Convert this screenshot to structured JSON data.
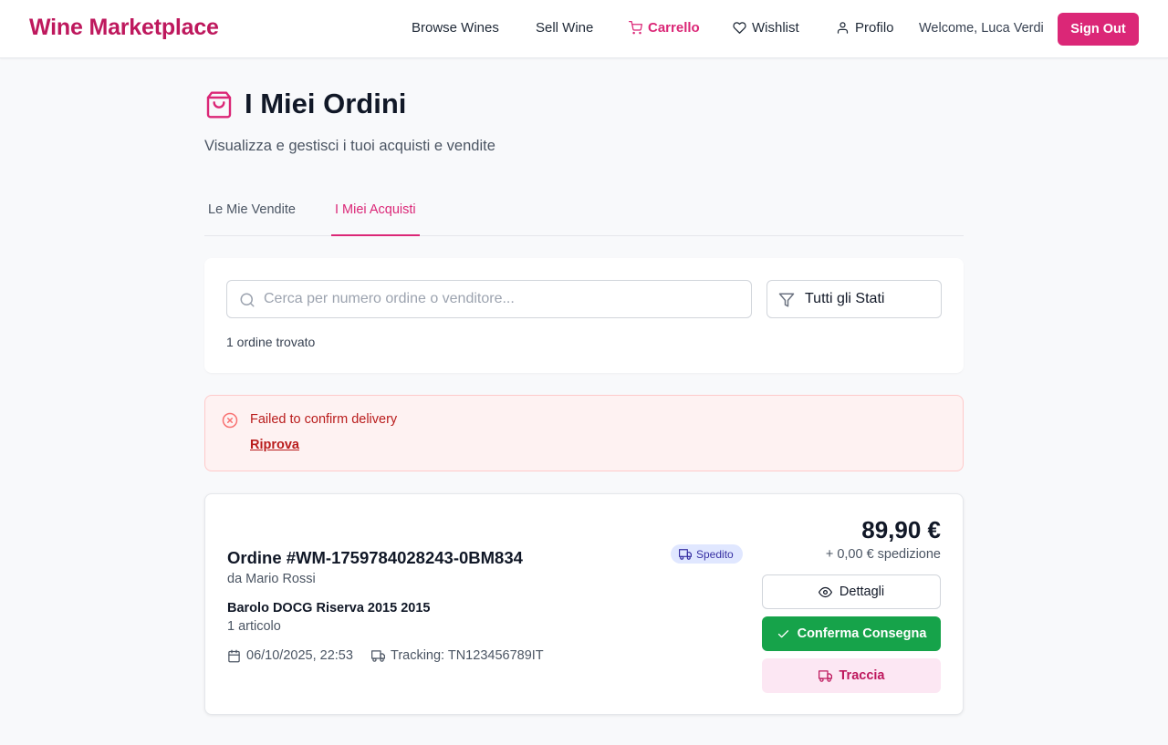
{
  "header": {
    "brand": "Wine Marketplace",
    "nav": {
      "browse": "Browse Wines",
      "sell": "Sell Wine",
      "cart": "Carrello",
      "wishlist": "Wishlist",
      "profile": "Profilo"
    },
    "welcome": "Welcome, Luca Verdi",
    "sign_out": "Sign Out"
  },
  "page": {
    "title": "I Miei Ordini",
    "subtitle": "Visualizza e gestisci i tuoi acquisti e vendite",
    "icon": "shopping-bag-icon"
  },
  "tabs": {
    "sales": "Le Mie Vendite",
    "purchases": "I Miei Acquisti",
    "active": "purchases"
  },
  "filters": {
    "search_placeholder": "Cerca per numero ordine o venditore...",
    "search_value": "",
    "status_selected": "Tutti gli Stati",
    "result_count": "1 ordine trovato"
  },
  "alert": {
    "message": "Failed to confirm delivery",
    "retry": "Riprova"
  },
  "order": {
    "title": "Ordine #WM-1759784028243-0BM834",
    "seller": "da Mario Rossi",
    "item": "Barolo DOCG Riserva 2015 2015",
    "quantity": "1 articolo",
    "date": "06/10/2025, 22:53",
    "tracking": "Tracking: TN123456789IT",
    "status": "Spedito",
    "price": "89,90 €",
    "shipping": "+ 0,00 € spedizione",
    "actions": {
      "details": "Dettagli",
      "confirm": "Conferma Consegna",
      "track": "Traccia"
    }
  },
  "colors": {
    "brand": "#be185d",
    "accent": "#db2777",
    "success": "#16a34a",
    "error": "#b91c1c",
    "status_badge_bg": "#e0e7ff"
  }
}
